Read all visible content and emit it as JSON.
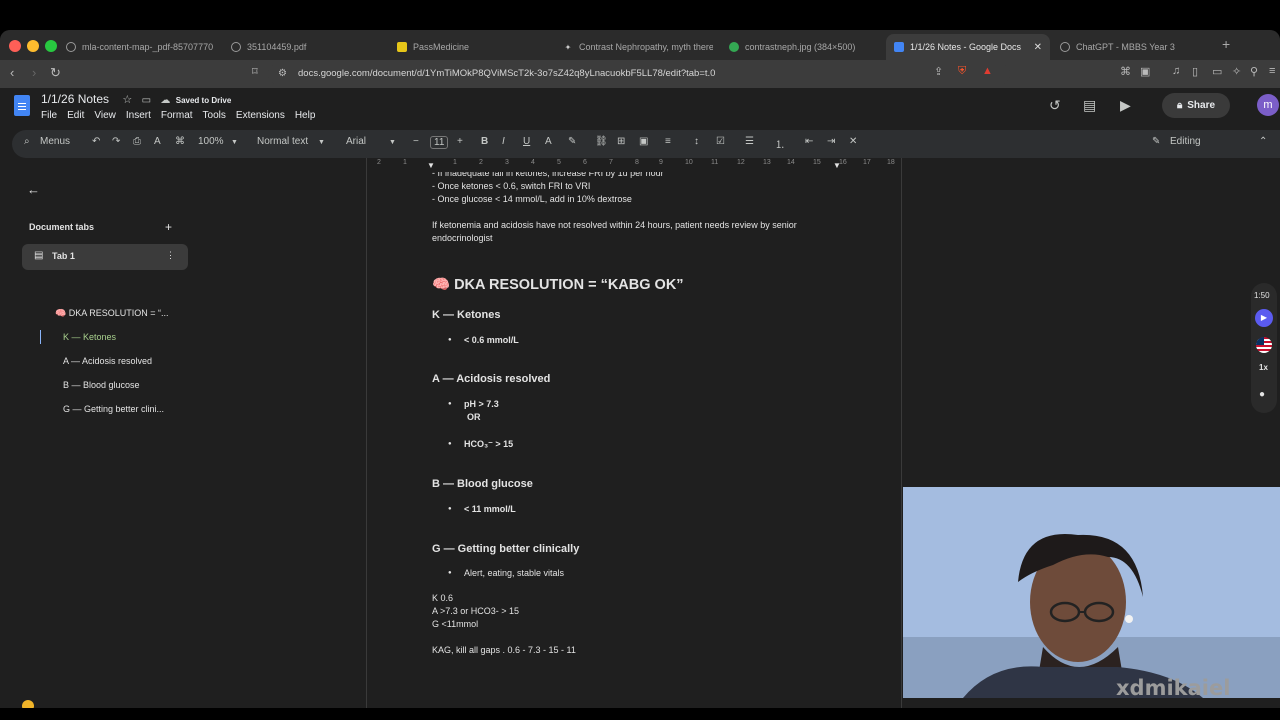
{
  "browser": {
    "tabs": [
      {
        "title": "mla-content-map-_pdf-85707770",
        "active": false
      },
      {
        "title": "351104459.pdf",
        "active": false
      },
      {
        "title": "PassMedicine",
        "active": false
      },
      {
        "title": "Contrast Nephropathy, myth there",
        "active": false
      },
      {
        "title": "contrastneph.jpg (384×500)",
        "active": false
      },
      {
        "title": "1/1/26 Notes - Google Docs",
        "active": true
      },
      {
        "title": "ChatGPT - MBBS Year 3",
        "active": false
      }
    ],
    "url": "docs.google.com/document/d/1YmTiMOkP8QViMScT2k-3o7sZ42q8yLnacuokbF5LL78/edit?tab=t.0"
  },
  "docs": {
    "title": "1/1/26 Notes",
    "saved_status": "Saved to Drive",
    "menu": [
      "File",
      "Edit",
      "View",
      "Insert",
      "Format",
      "Tools",
      "Extensions",
      "Help"
    ],
    "share_label": "Share",
    "avatar_letter": "m",
    "toolbar": {
      "menus_label": "Menus",
      "zoom": "100%",
      "style": "Normal text",
      "font": "Arial",
      "font_size": "11",
      "mode": "Editing"
    }
  },
  "sidebar": {
    "section_title": "Document tabs",
    "tab_label": "Tab 1",
    "outline": [
      {
        "label": "🧠 DKA RESOLUTION = “...",
        "highlighted": false
      },
      {
        "label": "K — Ketones",
        "highlighted": true
      },
      {
        "label": "A — Acidosis resolved",
        "highlighted": false
      },
      {
        "label": "B — Blood glucose",
        "highlighted": false
      },
      {
        "label": "G — Getting better clini...",
        "highlighted": false
      }
    ]
  },
  "ruler": [
    "2",
    "1",
    "1",
    "2",
    "3",
    "4",
    "5",
    "6",
    "7",
    "8",
    "9",
    "10",
    "11",
    "12",
    "13",
    "14",
    "15",
    "16",
    "17",
    "18"
  ],
  "document": {
    "top_lines": [
      "- If inadequate fall in ketones, increase FRI by 1u per hour",
      "- Once ketones < 0.6, switch FRI to VRI",
      "- Once glucose < 14 mmol/L, add in 10% dextrose"
    ],
    "review_note_1": "If ketonemia and acidosis have not resolved within 24 hours, patient needs review by senior",
    "review_note_2": "endocrinologist",
    "heading": "🧠 DKA RESOLUTION = “KABG OK”",
    "k_heading": "K — Ketones",
    "k_item": "< 0.6 mmol/L",
    "a_heading": "A — Acidosis resolved",
    "a_item1": "pH > 7.3",
    "a_or": "OR",
    "a_item2": "HCO₃⁻ > 15",
    "b_heading": "B — Blood glucose",
    "b_item": "< 11 mmol/L",
    "g_heading": "G — Getting better clinically",
    "g_item": "Alert, eating, stable vitals",
    "summary": [
      "K 0.6",
      "A >7.3 or HCO3- > 15",
      "G <11mmol"
    ],
    "mnemonic": "KAG, kill all gaps . 0.6 - 7.3 - 15 - 11"
  },
  "reader_widget": {
    "time": "1:50",
    "speed": "1x"
  },
  "watermark": "xdmikaiel"
}
